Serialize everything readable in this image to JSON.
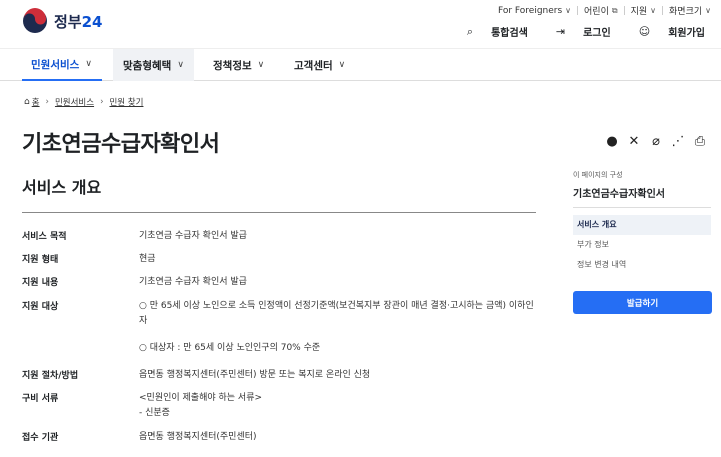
{
  "header": {
    "logo_text": "정부24",
    "util": [
      "For Foreigners",
      "어린이",
      "지원",
      "화면크기"
    ],
    "account": [
      {
        "icon": "search-icon",
        "label": "통합검색"
      },
      {
        "icon": "login-icon",
        "label": "로그인"
      },
      {
        "icon": "user-add-icon",
        "label": "회원가입"
      }
    ]
  },
  "gnb": [
    "민원서비스",
    "맞춤형혜택",
    "정책정보",
    "고객센터"
  ],
  "breadcrumb": [
    "홈",
    "민원서비스",
    "민원 찾기"
  ],
  "page_title": "기초연금수급자확인서",
  "share_icons": [
    "facebook-icon",
    "x-icon",
    "link-icon",
    "share-icon",
    "print-icon"
  ],
  "section_title": "서비스 개요",
  "rows": [
    {
      "key": "서비스 목적",
      "value": [
        "기초연금 수급자 확인서 발급"
      ]
    },
    {
      "key": "지원 형태",
      "value": [
        "현금"
      ]
    },
    {
      "key": "지원 내용",
      "value": [
        "기초연금 수급자 확인서 발급"
      ]
    },
    {
      "key": "지원 대상",
      "value": [
        "○ 만 65세 이상 노인으로 소득 인정액이 선정기준액(보건복지부 장관이 매년 결정·고시하는 금액) 이하인 자",
        "",
        "○ 대상자 : 만 65세 이상 노인인구의 70% 수준"
      ]
    },
    {
      "key": "지원 절차/방법",
      "value": [
        "읍면동 행정복지센터(주민센터) 방문 또는 복지로 온라인 신청"
      ]
    },
    {
      "key": "구비 서류",
      "value": [
        "<민원인이 제출해야 하는 서류>",
        "- 신분증"
      ]
    },
    {
      "key": "접수 기관",
      "value": [
        "읍면동 행정복지센터(주민센터)"
      ]
    }
  ],
  "sidebar": {
    "label": "이 페이지의 구성",
    "title": "기초연금수급자확인서",
    "items": [
      "서비스 개요",
      "부가 정보",
      "정보 변경 내역"
    ],
    "apply_button": "발급하기"
  },
  "colors": {
    "primary": "#256ef4",
    "brand_red": "#cd2e3a",
    "brand_blue": "#0b50d0"
  }
}
